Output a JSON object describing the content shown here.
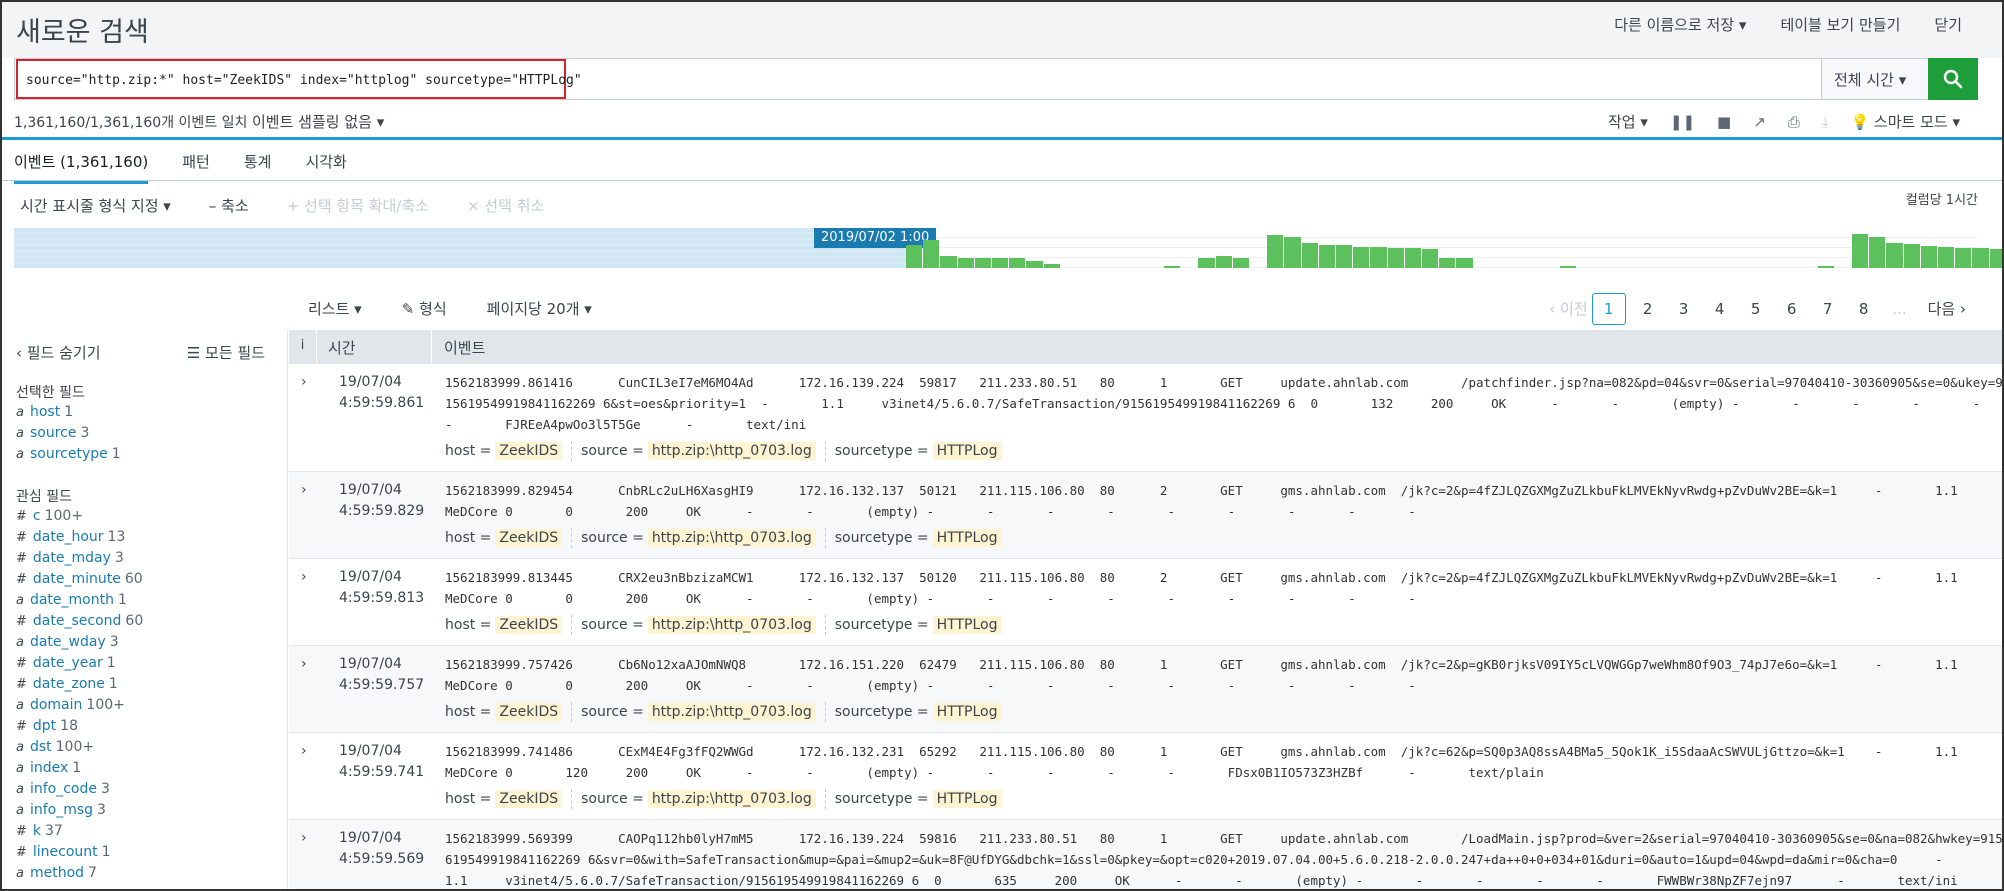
{
  "header": {
    "title": "새로운 검색",
    "save_as": "다른 이름으로 저장 ▾",
    "create_table": "테이블 보기 만들기",
    "close": "닫기"
  },
  "search": {
    "query": "source=\"http.zip:*\" host=\"ZeekIDS\" index=\"httplog\" sourcetype=\"HTTPLog\"",
    "time_range": "전체 시간 ▾"
  },
  "status": {
    "match_text": "1,361,160/1,361,160개 이벤트 일치",
    "sampling": "이벤트 샘플링 없음 ▾",
    "job": "작업 ▾",
    "mode": "스마트 모드 ▾"
  },
  "tabs": [
    "이벤트 (1,361,160)",
    "패턴",
    "통계",
    "시각화"
  ],
  "timeline": {
    "format": "시간 표시줄 형식 지정 ▾",
    "zoom_out": "– 축소",
    "zoom_sel": "+ 선택 항목 확대/축소",
    "deselect": "× 선택 취소",
    "scale": "컬럼당 1시간",
    "selected_label": "2019/07/02 1:00",
    "bars": [
      0.68,
      0.82,
      0.35,
      0.3,
      0.3,
      0.3,
      0.3,
      0.2,
      0.12,
      0.0,
      0.0,
      0.0,
      0.0,
      0.0,
      0.0,
      0.05,
      0.0,
      0.3,
      0.35,
      0.3,
      0.0,
      0.98,
      0.9,
      0.75,
      0.68,
      0.68,
      0.62,
      0.62,
      0.6,
      0.6,
      0.55,
      0.3,
      0.3,
      0.0,
      0.0,
      0.0,
      0.0,
      0.0,
      0.05,
      0.0,
      0.0,
      0.0,
      0.0,
      0.0,
      0.0,
      0.0,
      0.0,
      0.0,
      0.0,
      0.0,
      0.0,
      0.0,
      0.0,
      0.05,
      0.0,
      1.0,
      0.9,
      0.75,
      0.7,
      0.65,
      0.62,
      0.6,
      0.58,
      0.55,
      0.48
    ]
  },
  "list": {
    "view": "리스트 ▾",
    "format": "✎ 형식",
    "per_page": "페이지당 20개 ▾"
  },
  "pager": {
    "prev": "‹ 이전",
    "pages": [
      "1",
      "2",
      "3",
      "4",
      "5",
      "6",
      "7",
      "8"
    ],
    "ellipsis": "...",
    "next": "다음 ›"
  },
  "sidebar": {
    "hide_fields": "‹ 필드 숨기기",
    "all_fields": "☰ 모든 필드",
    "selected_title": "선택한 필드",
    "selected_fields": [
      {
        "type": "a",
        "name": "host",
        "count": "1"
      },
      {
        "type": "a",
        "name": "source",
        "count": "3"
      },
      {
        "type": "a",
        "name": "sourcetype",
        "count": "1"
      }
    ],
    "interest_title": "관심 필드",
    "interest_fields": [
      {
        "type": "#",
        "name": "c",
        "count": "100+"
      },
      {
        "type": "#",
        "name": "date_hour",
        "count": "13"
      },
      {
        "type": "#",
        "name": "date_mday",
        "count": "3"
      },
      {
        "type": "#",
        "name": "date_minute",
        "count": "60"
      },
      {
        "type": "a",
        "name": "date_month",
        "count": "1"
      },
      {
        "type": "#",
        "name": "date_second",
        "count": "60"
      },
      {
        "type": "a",
        "name": "date_wday",
        "count": "3"
      },
      {
        "type": "#",
        "name": "date_year",
        "count": "1"
      },
      {
        "type": "#",
        "name": "date_zone",
        "count": "1"
      },
      {
        "type": "a",
        "name": "domain",
        "count": "100+"
      },
      {
        "type": "#",
        "name": "dpt",
        "count": "18"
      },
      {
        "type": "a",
        "name": "dst",
        "count": "100+"
      },
      {
        "type": "a",
        "name": "index",
        "count": "1"
      },
      {
        "type": "a",
        "name": "info_code",
        "count": "3"
      },
      {
        "type": "a",
        "name": "info_msg",
        "count": "3"
      },
      {
        "type": "#",
        "name": "k",
        "count": "37"
      },
      {
        "type": "#",
        "name": "linecount",
        "count": "1"
      },
      {
        "type": "a",
        "name": "method",
        "count": "7"
      }
    ]
  },
  "table": {
    "col_info": "i",
    "col_time": "시간",
    "col_event": "이벤트",
    "meta_labels": {
      "host": "host =",
      "source": "source =",
      "sourcetype": "sourcetype ="
    },
    "rows": [
      {
        "date": "19/07/04",
        "time": "4:59:59.861",
        "lines": [
          "1562183999.861416      CunCIL3eI7eM6MO4Ad      172.16.139.224  59817   211.233.80.51   80      1       GET     update.ahnlab.com       /patchfinder.jsp?na=082&pd=04&svr=0&serial=97040410-30360905&se=0&ukey=9",
          "15619549919841162269 6&st=oes&priority=1  -       1.1     v3inet4/5.6.0.7/SafeTransaction/915619549919841162269 6  0       132     200     OK      -       -       (empty) -       -       -       -       -",
          "-       FJREeA4pwOo3l5T5Ge      -       text/ini"
        ],
        "host": "ZeekIDS",
        "source": "http.zip:\\http_0703.log",
        "sourcetype": "HTTPLog"
      },
      {
        "date": "19/07/04",
        "time": "4:59:59.829",
        "lines": [
          "1562183999.829454      CnbRLc2uLH6XasgHI9      172.16.132.137  50121   211.115.106.80  80      2       GET     gms.ahnlab.com  /jk?c=2&p=4fZJLQZGXMgZuZLkbuFkLMVEkNyvRwdg+pZvDuWv2BE=&k=1     -       1.1",
          "MeDCore 0       0       200     OK      -       -       (empty) -       -       -       -       -       -       -       -       -"
        ],
        "host": "ZeekIDS",
        "source": "http.zip:\\http_0703.log",
        "sourcetype": "HTTPLog"
      },
      {
        "date": "19/07/04",
        "time": "4:59:59.813",
        "lines": [
          "1562183999.813445      CRX2eu3nBbzizaMCW1      172.16.132.137  50120   211.115.106.80  80      2       GET     gms.ahnlab.com  /jk?c=2&p=4fZJLQZGXMgZuZLkbuFkLMVEkNyvRwdg+pZvDuWv2BE=&k=1     -       1.1",
          "MeDCore 0       0       200     OK      -       -       (empty) -       -       -       -       -       -       -       -       -"
        ],
        "host": "ZeekIDS",
        "source": "http.zip:\\http_0703.log",
        "sourcetype": "HTTPLog"
      },
      {
        "date": "19/07/04",
        "time": "4:59:59.757",
        "lines": [
          "1562183999.757426      Cb6No12xaAJOmNWQ8       172.16.151.220  62479   211.115.106.80  80      1       GET     gms.ahnlab.com  /jk?c=2&p=gKB0rjksV09IY5cLVQWGGp7weWhm8Of9O3_74pJ7e6o=&k=1     -       1.1",
          "MeDCore 0       0       200     OK      -       -       (empty) -       -       -       -       -       -       -       -       -"
        ],
        "host": "ZeekIDS",
        "source": "http.zip:\\http_0703.log",
        "sourcetype": "HTTPLog"
      },
      {
        "date": "19/07/04",
        "time": "4:59:59.741",
        "lines": [
          "1562183999.741486      CExM4E4Fg3fFQ2WWGd      172.16.132.231  65292   211.115.106.80  80      1       GET     gms.ahnlab.com  /jk?c=62&p=SQ0p3AQ8ssA4BMa5_5Qok1K_i5SdaaAcSWVULjGttzo=&k=1    -       1.1",
          "MeDCore 0       120     200     OK      -       -       (empty) -       -       -       -       -       FDsx0B1IO573Z3HZBf      -       text/plain"
        ],
        "host": "ZeekIDS",
        "source": "http.zip:\\http_0703.log",
        "sourcetype": "HTTPLog"
      },
      {
        "date": "19/07/04",
        "time": "4:59:59.569",
        "lines": [
          "1562183999.569399      CAOPq112hb0lyH7mM5      172.16.139.224  59816   211.233.80.51   80      1       GET     update.ahnlab.com       /LoadMain.jsp?prod=&ver=2&serial=97040410-30360905&se=0&na=082&hwkey=915",
          "619549919841162269 6&svr=0&with=SafeTransaction&mup=&pai=&mup2=&uk=8F@UfDYG&dbchk=1&ssl=0&pkey=&opt=c020+2019.07.04.00+5.6.0.218-2.0.0.247+da++0+0+034+01&duri=0&auto=1&upd=04&wpd=da&mir=0&cha=0     -",
          "1.1     v3inet4/5.6.0.7/SafeTransaction/915619549919841162269 6  0       635     200     OK      -       -       (empty) -       -       -       -       -       FWWBWr38NpZF7ejn97      -       text/ini"
        ],
        "host": "ZeekIDS",
        "source": "http.zip:\\http_0703.log",
        "sourcetype": "HTTPLog"
      }
    ]
  }
}
